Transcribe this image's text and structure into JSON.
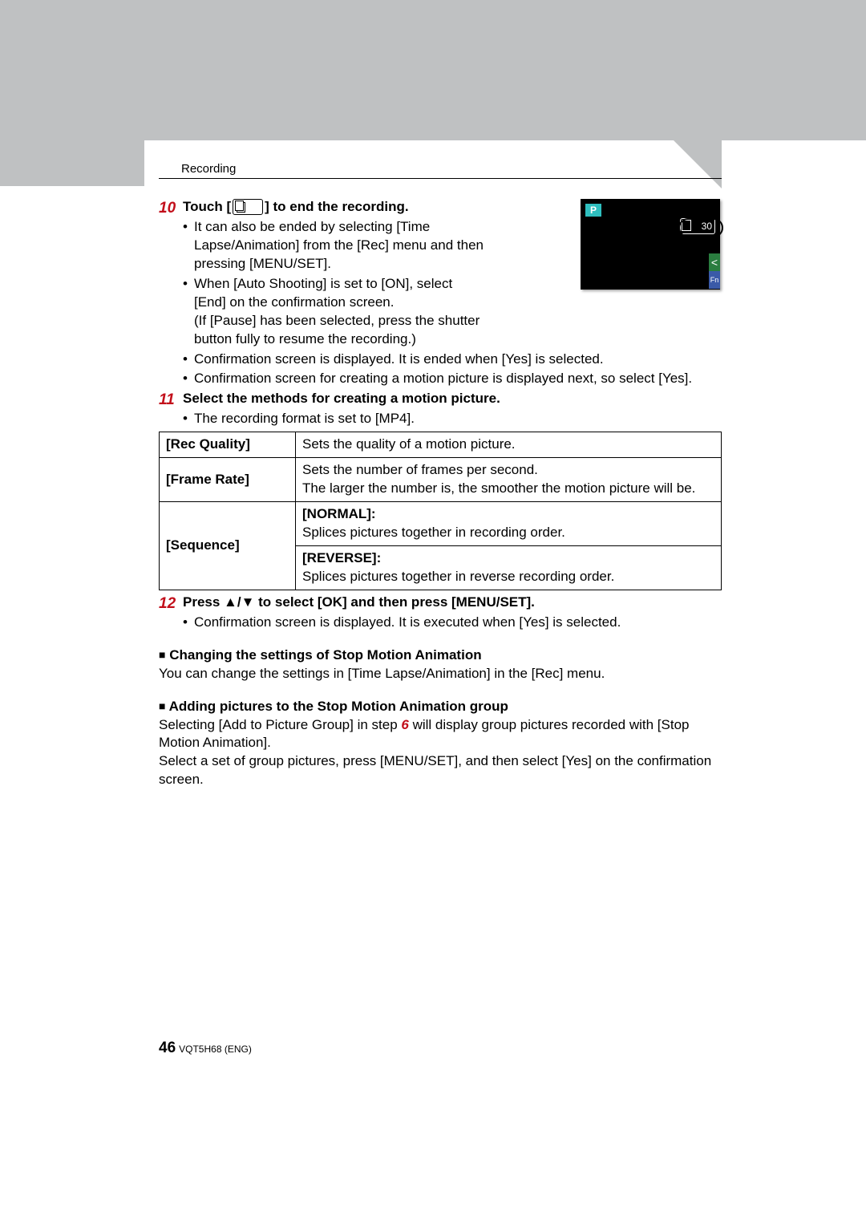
{
  "breadcrumb": "Recording",
  "lcd": {
    "mode": "P",
    "count": "30",
    "arrow": "<",
    "fn": "Fn"
  },
  "step10": {
    "num": "10",
    "title_prefix": "Touch [",
    "title_suffix": "] to end the recording.",
    "bullets": [
      "It can also be ended by selecting [Time Lapse/Animation] from the [Rec] menu and then pressing [MENU/SET].",
      "When [Auto Shooting] is set to [ON], select [End] on the confirmation screen.\n(If [Pause] has been selected, press the shutter button fully to resume the recording.)",
      "Confirmation screen is displayed. It is ended when [Yes] is selected.",
      "Confirmation screen for creating a motion picture is displayed next, so select [Yes]."
    ]
  },
  "step11": {
    "num": "11",
    "title": "Select the methods for creating a motion picture.",
    "sub": "The recording format is set to [MP4].",
    "table": {
      "rows": [
        {
          "key": "[Rec Quality]",
          "val": "Sets the quality of a motion picture."
        },
        {
          "key": "[Frame Rate]",
          "val": "Sets the number of frames per second.\nThe larger the number is, the smoother the motion picture will be."
        }
      ],
      "seq": {
        "key": "[Sequence]",
        "normal_label": "[NORMAL]:",
        "normal_text": "Splices pictures together in recording order.",
        "reverse_label": "[REVERSE]:",
        "reverse_text": "Splices pictures together in reverse recording order."
      }
    }
  },
  "step12": {
    "num": "12",
    "title": "Press ▲/▼ to select [OK] and then press [MENU/SET].",
    "sub": "Confirmation screen is displayed. It is executed when [Yes] is selected."
  },
  "section_change": {
    "title": "Changing the settings of Stop Motion Animation",
    "text": "You can change the settings in [Time Lapse/Animation] in the [Rec] menu."
  },
  "section_add": {
    "title": "Adding pictures to the Stop Motion Animation group",
    "p1a": "Selecting [Add to Picture Group] in step ",
    "p1b": "6",
    "p1c": " will display group pictures recorded with [Stop Motion Animation].",
    "p2": "Select a set of group pictures, press [MENU/SET], and then select [Yes] on the confirmation screen."
  },
  "footer": {
    "page": "46",
    "doc_id": "VQT5H68 (ENG)"
  }
}
